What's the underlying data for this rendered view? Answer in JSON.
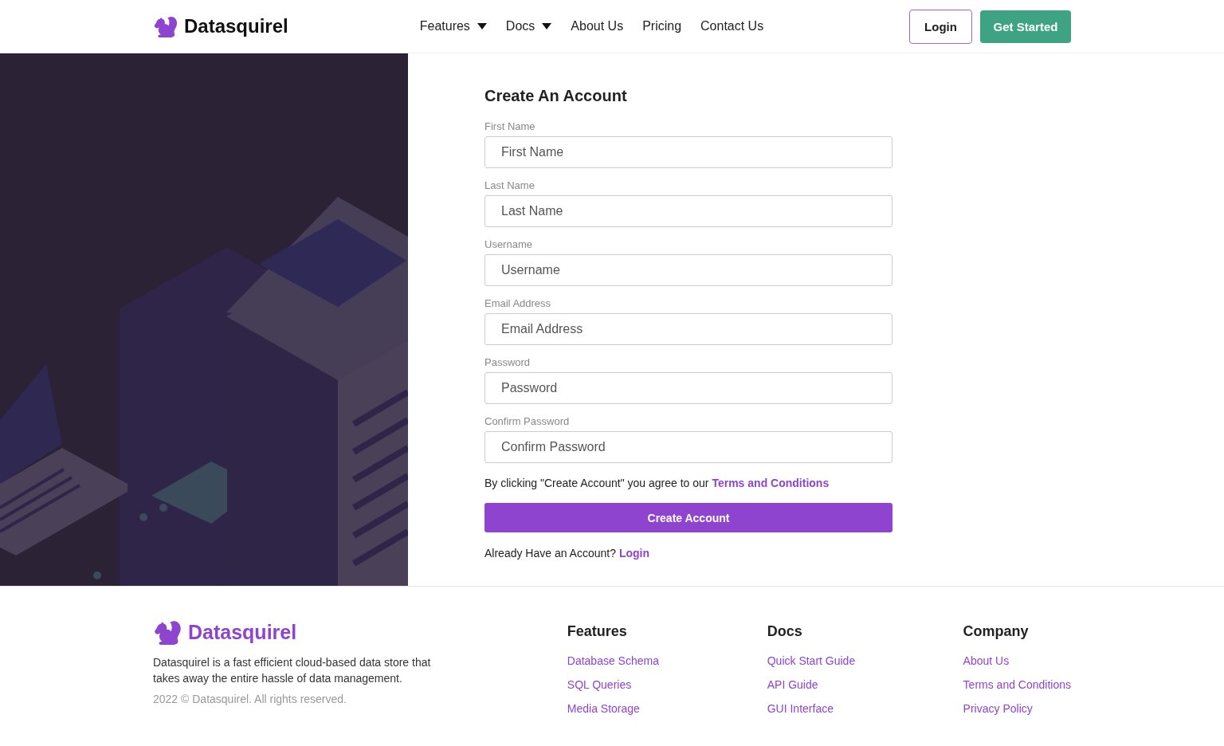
{
  "header": {
    "brand": "Datasquirel",
    "nav": [
      {
        "label": "Features",
        "dropdown": true
      },
      {
        "label": "Docs",
        "dropdown": true
      },
      {
        "label": "About Us",
        "dropdown": false
      },
      {
        "label": "Pricing",
        "dropdown": false
      },
      {
        "label": "Contact Us",
        "dropdown": false
      }
    ],
    "login": "Login",
    "get_started": "Get Started"
  },
  "form": {
    "title": "Create An Account",
    "fields": [
      {
        "label": "First Name",
        "placeholder": "First Name"
      },
      {
        "label": "Last Name",
        "placeholder": "Last Name"
      },
      {
        "label": "Username",
        "placeholder": "Username"
      },
      {
        "label": "Email Address",
        "placeholder": "Email Address"
      },
      {
        "label": "Password",
        "placeholder": "Password"
      },
      {
        "label": "Confirm Password",
        "placeholder": "Confirm Password"
      }
    ],
    "agreement": "By clicking \"Create Account\" you agree to our",
    "terms_link": "Terms and Conditions",
    "submit": "Create Account",
    "login_prompt": "Already Have an Account?",
    "login_link": "Login"
  },
  "footer": {
    "brand": "Datasquirel",
    "description": "Datasquirel is a fast efficient cloud-based data store that takes away the entire hassle of data management.",
    "copyright": "2022 © Datasquirel. All rights reserved.",
    "columns": [
      {
        "title": "Features",
        "links": [
          "Database Schema",
          "SQL Queries",
          "Media Storage"
        ]
      },
      {
        "title": "Docs",
        "links": [
          "Quick Start Guide",
          "API Guide",
          "GUI Interface"
        ]
      },
      {
        "title": "Company",
        "links": [
          "About Us",
          "Terms and Conditions",
          "Privacy Policy"
        ]
      }
    ]
  }
}
